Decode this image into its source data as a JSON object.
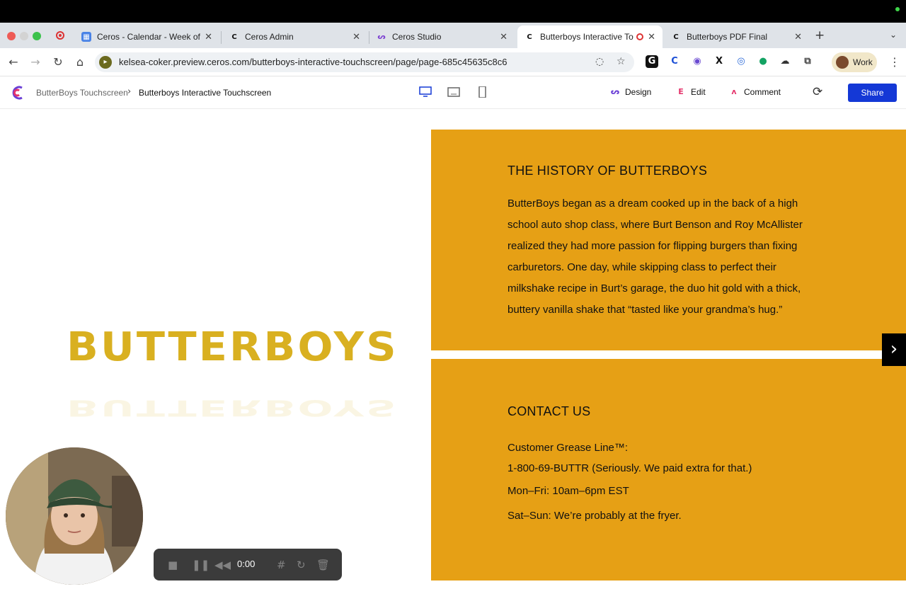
{
  "browser": {
    "tabs": [
      {
        "title": "Ceros - Calendar - Week of J",
        "favicon": "calendar-icon"
      },
      {
        "title": "Ceros Admin",
        "favicon": "ceros-icon"
      },
      {
        "title": "Ceros Studio",
        "favicon": "ceros-studio-icon"
      },
      {
        "title": "Butterboys Interactive To",
        "favicon": "ceros-icon",
        "active": true
      },
      {
        "title": "Butterboys PDF Final",
        "favicon": "ceros-icon"
      }
    ],
    "new_tab_label": "+",
    "url": "kelsea-coker.preview.ceros.com/butterboys-interactive-touchscreen/page/page-685c45635c8c6",
    "profile_label": "Work"
  },
  "app": {
    "breadcrumb_parent": "ButterBoys Touchscreen",
    "breadcrumb_current": "Butterboys Interactive Touchscreen",
    "modes": {
      "design": "Design",
      "edit": "Edit",
      "comment": "Comment"
    },
    "share_label": "Share",
    "accent_color": "#1438d6"
  },
  "page": {
    "brand_wordmark": "BUTTERBOYS",
    "panel_color": "#e6a015",
    "history": {
      "heading": "THE HISTORY OF BUTTERBOYS",
      "body": "ButterBoys began as a dream cooked up in the back of a high school auto shop class, where Burt Benson and Roy McAllister realized they had more passion for flipping burgers than fixing carburetors. One day, while skipping class to perfect their milkshake recipe in Burt’s garage, the duo hit gold with a thick, buttery vanilla shake that “tasted like your grandma’s hug.”"
    },
    "contact": {
      "heading": "CONTACT US",
      "line_label": "Customer Grease Line™:",
      "phone": "1-800-69-BUTTR (Seriously. We paid extra for that.)",
      "weekday_hours": "Mon–Fri: 10am–6pm EST",
      "weekend_hours": "Sat–Sun: We’re probably at the fryer."
    }
  },
  "recorder": {
    "time": "0:00"
  }
}
